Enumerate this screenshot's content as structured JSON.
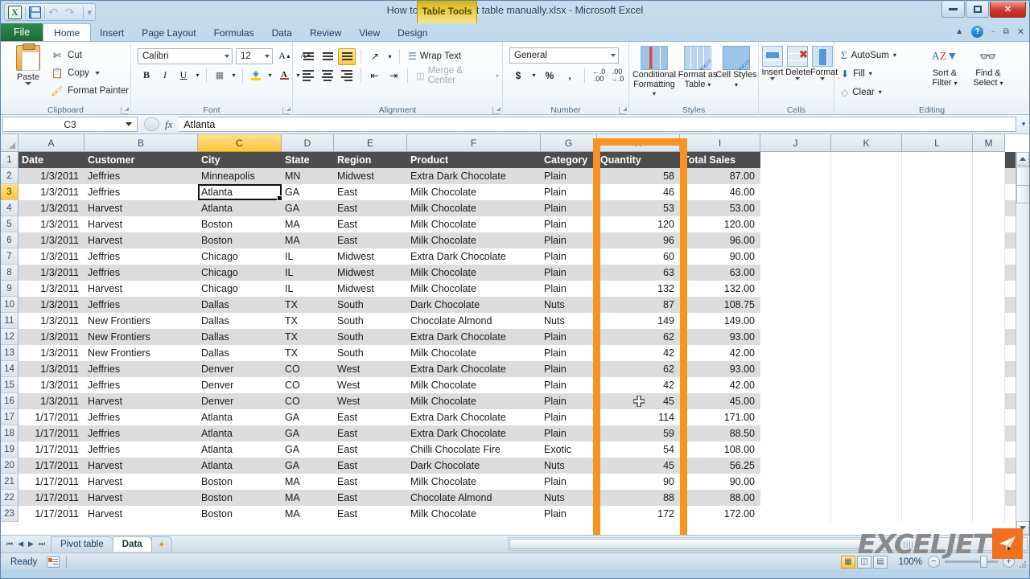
{
  "window": {
    "title": "How to group a pivot table manually.xlsx  -  Microsoft Excel",
    "contextual_tab_group": "Table Tools",
    "quick_access": [
      "save-icon",
      "undo-icon",
      "redo-icon",
      "customize-qat-icon"
    ],
    "buttons": {
      "minimize": "minimize-button",
      "restore": "restore-button",
      "close": "close-button"
    }
  },
  "ribbon": {
    "tabs": [
      "File",
      "Home",
      "Insert",
      "Page Layout",
      "Formulas",
      "Data",
      "Review",
      "View",
      "Design"
    ],
    "active_tab": "Home",
    "groups": {
      "clipboard": {
        "label": "Clipboard",
        "paste": "Paste",
        "items": [
          "Cut",
          "Copy",
          "Format Painter"
        ]
      },
      "font": {
        "label": "Font",
        "font_name": "Calibri",
        "font_size": "12",
        "bold": "B",
        "italic": "I",
        "underline": "U"
      },
      "alignment": {
        "label": "Alignment",
        "wrap_text": "Wrap Text",
        "merge_center": "Merge & Center"
      },
      "number": {
        "label": "Number",
        "format": "General",
        "currency": "$",
        "percent": "%",
        "comma": ","
      },
      "styles": {
        "label": "Styles",
        "items": [
          "Conditional Formatting",
          "Format as Table",
          "Cell Styles"
        ]
      },
      "cells": {
        "label": "Cells",
        "items": [
          "Insert",
          "Delete",
          "Format"
        ]
      },
      "editing": {
        "label": "Editing",
        "items": [
          "AutoSum",
          "Fill",
          "Clear",
          "Sort & Filter",
          "Find & Select"
        ]
      }
    }
  },
  "formula_bar": {
    "name_box": "C3",
    "formula": "Atlanta",
    "fx_label": "fx"
  },
  "grid": {
    "columns": [
      {
        "letter": "A",
        "width": 82
      },
      {
        "letter": "B",
        "width": 141
      },
      {
        "letter": "C",
        "width": 104
      },
      {
        "letter": "D",
        "width": 65
      },
      {
        "letter": "E",
        "width": 91
      },
      {
        "letter": "F",
        "width": 166
      },
      {
        "letter": "G",
        "width": 70
      },
      {
        "letter": "H",
        "width": 103
      },
      {
        "letter": "I",
        "width": 100
      },
      {
        "letter": "J",
        "width": 88
      },
      {
        "letter": "K",
        "width": 88
      },
      {
        "letter": "L",
        "width": 88
      },
      {
        "letter": "M",
        "width": 40
      }
    ],
    "selected_column": "C",
    "selected_row": 3,
    "selected_cell": "C3",
    "headers": [
      "Date",
      "Customer",
      "City",
      "State",
      "Region",
      "Product",
      "Category",
      "Quantity",
      "Total Sales"
    ],
    "rows": [
      {
        "n": 2,
        "date": "1/3/2011",
        "customer": "Jeffries",
        "city": "Minneapolis",
        "state": "MN",
        "region": "Midwest",
        "product": "Extra Dark Chocolate",
        "category": "Plain",
        "quantity": "58",
        "total": "87.00"
      },
      {
        "n": 3,
        "date": "1/3/2011",
        "customer": "Jeffries",
        "city": "Atlanta",
        "state": "GA",
        "region": "East",
        "product": "Milk Chocolate",
        "category": "Plain",
        "quantity": "46",
        "total": "46.00"
      },
      {
        "n": 4,
        "date": "1/3/2011",
        "customer": "Harvest",
        "city": "Atlanta",
        "state": "GA",
        "region": "East",
        "product": "Milk Chocolate",
        "category": "Plain",
        "quantity": "53",
        "total": "53.00"
      },
      {
        "n": 5,
        "date": "1/3/2011",
        "customer": "Harvest",
        "city": "Boston",
        "state": "MA",
        "region": "East",
        "product": "Milk Chocolate",
        "category": "Plain",
        "quantity": "120",
        "total": "120.00"
      },
      {
        "n": 6,
        "date": "1/3/2011",
        "customer": "Harvest",
        "city": "Boston",
        "state": "MA",
        "region": "East",
        "product": "Milk Chocolate",
        "category": "Plain",
        "quantity": "96",
        "total": "96.00"
      },
      {
        "n": 7,
        "date": "1/3/2011",
        "customer": "Jeffries",
        "city": "Chicago",
        "state": "IL",
        "region": "Midwest",
        "product": "Extra Dark Chocolate",
        "category": "Plain",
        "quantity": "60",
        "total": "90.00"
      },
      {
        "n": 8,
        "date": "1/3/2011",
        "customer": "Jeffries",
        "city": "Chicago",
        "state": "IL",
        "region": "Midwest",
        "product": "Milk Chocolate",
        "category": "Plain",
        "quantity": "63",
        "total": "63.00"
      },
      {
        "n": 9,
        "date": "1/3/2011",
        "customer": "Harvest",
        "city": "Chicago",
        "state": "IL",
        "region": "Midwest",
        "product": "Milk Chocolate",
        "category": "Plain",
        "quantity": "132",
        "total": "132.00"
      },
      {
        "n": 10,
        "date": "1/3/2011",
        "customer": "Jeffries",
        "city": "Dallas",
        "state": "TX",
        "region": "South",
        "product": "Dark Chocolate",
        "category": "Nuts",
        "quantity": "87",
        "total": "108.75"
      },
      {
        "n": 11,
        "date": "1/3/2011",
        "customer": "New Frontiers",
        "city": "Dallas",
        "state": "TX",
        "region": "South",
        "product": "Chocolate Almond",
        "category": "Nuts",
        "quantity": "149",
        "total": "149.00"
      },
      {
        "n": 12,
        "date": "1/3/2011",
        "customer": "New Frontiers",
        "city": "Dallas",
        "state": "TX",
        "region": "South",
        "product": "Extra Dark Chocolate",
        "category": "Plain",
        "quantity": "62",
        "total": "93.00"
      },
      {
        "n": 13,
        "date": "1/3/2011",
        "customer": "New Frontiers",
        "city": "Dallas",
        "state": "TX",
        "region": "South",
        "product": "Milk Chocolate",
        "category": "Plain",
        "quantity": "42",
        "total": "42.00"
      },
      {
        "n": 14,
        "date": "1/3/2011",
        "customer": "Jeffries",
        "city": "Denver",
        "state": "CO",
        "region": "West",
        "product": "Extra Dark Chocolate",
        "category": "Plain",
        "quantity": "62",
        "total": "93.00"
      },
      {
        "n": 15,
        "date": "1/3/2011",
        "customer": "Jeffries",
        "city": "Denver",
        "state": "CO",
        "region": "West",
        "product": "Milk Chocolate",
        "category": "Plain",
        "quantity": "42",
        "total": "42.00"
      },
      {
        "n": 16,
        "date": "1/3/2011",
        "customer": "Harvest",
        "city": "Denver",
        "state": "CO",
        "region": "West",
        "product": "Milk Chocolate",
        "category": "Plain",
        "quantity": "45",
        "total": "45.00"
      },
      {
        "n": 17,
        "date": "1/17/2011",
        "customer": "Jeffries",
        "city": "Atlanta",
        "state": "GA",
        "region": "East",
        "product": "Extra Dark Chocolate",
        "category": "Plain",
        "quantity": "114",
        "total": "171.00"
      },
      {
        "n": 18,
        "date": "1/17/2011",
        "customer": "Jeffries",
        "city": "Atlanta",
        "state": "GA",
        "region": "East",
        "product": "Extra Dark Chocolate",
        "category": "Plain",
        "quantity": "59",
        "total": "88.50"
      },
      {
        "n": 19,
        "date": "1/17/2011",
        "customer": "Jeffries",
        "city": "Atlanta",
        "state": "GA",
        "region": "East",
        "product": "Chilli Chocolate Fire",
        "category": "Exotic",
        "quantity": "54",
        "total": "108.00"
      },
      {
        "n": 20,
        "date": "1/17/2011",
        "customer": "Harvest",
        "city": "Atlanta",
        "state": "GA",
        "region": "East",
        "product": "Dark Chocolate",
        "category": "Nuts",
        "quantity": "45",
        "total": "56.25"
      },
      {
        "n": 21,
        "date": "1/17/2011",
        "customer": "Harvest",
        "city": "Boston",
        "state": "MA",
        "region": "East",
        "product": "Milk Chocolate",
        "category": "Plain",
        "quantity": "90",
        "total": "90.00"
      },
      {
        "n": 22,
        "date": "1/17/2011",
        "customer": "Harvest",
        "city": "Boston",
        "state": "MA",
        "region": "East",
        "product": "Chocolate Almond",
        "category": "Nuts",
        "quantity": "88",
        "total": "88.00"
      },
      {
        "n": 23,
        "date": "1/17/2011",
        "customer": "Harvest",
        "city": "Boston",
        "state": "MA",
        "region": "East",
        "product": "Milk Chocolate",
        "category": "Plain",
        "quantity": "172",
        "total": "172.00"
      }
    ]
  },
  "annotation": {
    "color": "#f79420",
    "target_column": "H",
    "shape": "rectangle-outline"
  },
  "sheet_tabs": {
    "tabs": [
      "Pivot table",
      "Data"
    ],
    "active": "Data",
    "new_sheet": "insert-worksheet-icon"
  },
  "status_bar": {
    "state": "Ready",
    "zoom": "100%",
    "views": [
      "normal-view",
      "page-layout-view",
      "page-break-preview"
    ],
    "active_view": "normal-view"
  },
  "watermark": {
    "text": "EXCELJET",
    "accent": "#f1701f"
  }
}
